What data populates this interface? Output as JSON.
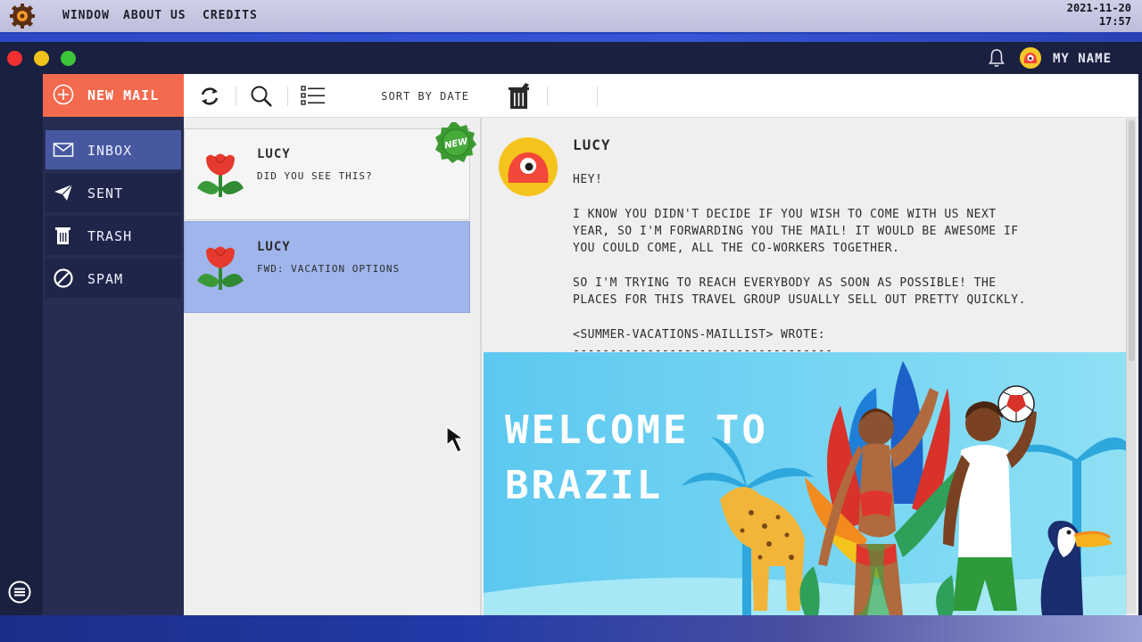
{
  "os_bar": {
    "menu": [
      "WINDOW",
      "ABOUT US",
      "CREDITS"
    ],
    "date": "2021-11-20",
    "time": "17:57"
  },
  "header": {
    "user_name": "MY NAME"
  },
  "sidebar": {
    "new_mail": "NEW MAIL",
    "items": [
      {
        "label": "INBOX",
        "icon": "envelope-icon",
        "active": true
      },
      {
        "label": "SENT",
        "icon": "paper-plane-icon",
        "active": false
      },
      {
        "label": "TRASH",
        "icon": "trash-icon",
        "active": false
      },
      {
        "label": "SPAM",
        "icon": "prohibited-icon",
        "active": false
      }
    ]
  },
  "list_toolbar": {
    "sort_label": "SORT BY DATE"
  },
  "mails": [
    {
      "sender": "LUCY",
      "subject": "DID YOU SEE THIS?",
      "badge": "NEW",
      "selected": false
    },
    {
      "sender": "LUCY",
      "subject": "FWD: VACATION OPTIONS",
      "selected": true
    }
  ],
  "message": {
    "from": "LUCY",
    "lines": [
      "HEY!",
      "I KNOW YOU DIDN'T DECIDE IF YOU WISH TO COME WITH US NEXT",
      "YEAR, SO I'M FORWARDING YOU THE MAIL! IT WOULD BE AWESOME IF",
      "YOU COULD COME, ALL THE CO-WORKERS TOGETHER.",
      "SO I'M TRYING TO REACH EVERYBODY AS SOON AS POSSIBLE! THE",
      "PLACES FOR THIS TRAVEL GROUP USUALLY SELL OUT PRETTY QUICKLY.",
      "<SUMMER-VACATIONS-MAILLIST> WROTE:",
      "-----------------------------------"
    ],
    "banner_line_1": "WELCOME TO",
    "banner_line_2": "BRAZIL"
  },
  "colors": {
    "accent": "#f36a4f",
    "sidebar": "#262c52",
    "selected_mail": "#9fb5ec",
    "active_nav": "#4758a0"
  }
}
